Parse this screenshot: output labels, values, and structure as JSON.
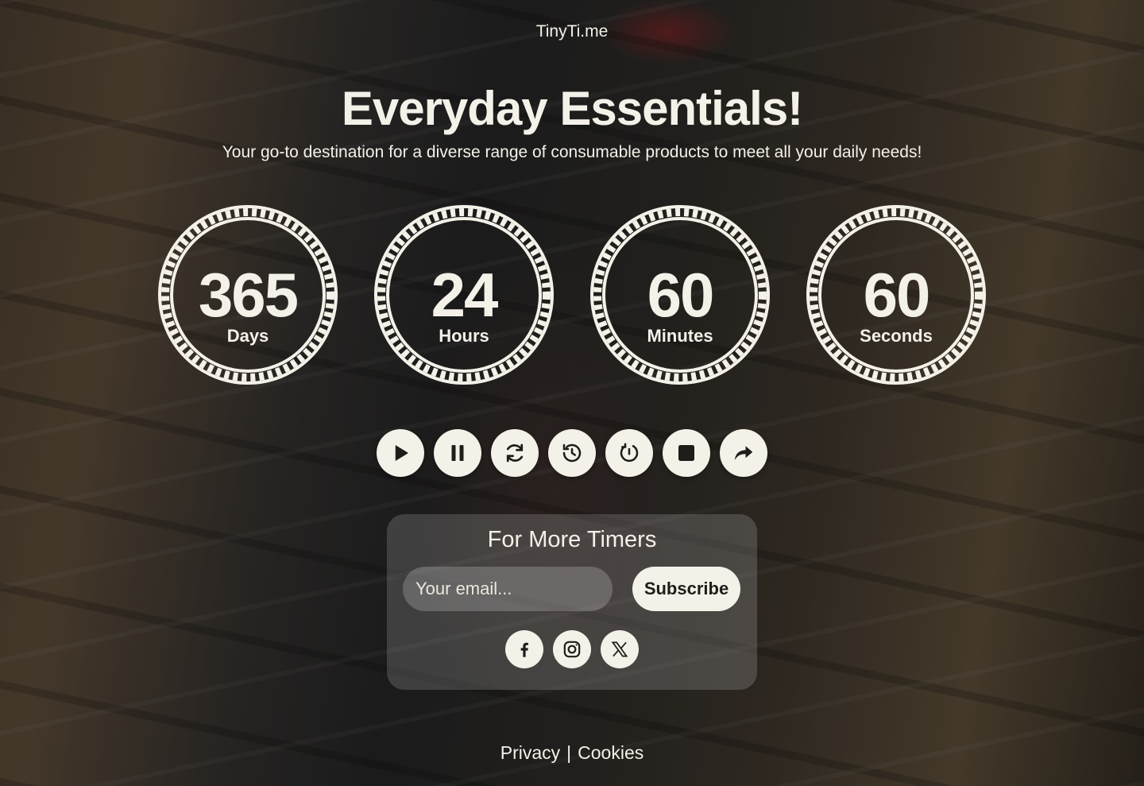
{
  "brand": "TinyTi.me",
  "hero": {
    "title": "Everyday Essentials!",
    "subtitle": "Your go-to destination for a diverse range of consumable products to meet all your daily needs!"
  },
  "countdown": [
    {
      "value": "365",
      "label": "Days"
    },
    {
      "value": "24",
      "label": "Hours"
    },
    {
      "value": "60",
      "label": "Minutes"
    },
    {
      "value": "60",
      "label": "Seconds"
    }
  ],
  "controls": [
    {
      "name": "play-icon"
    },
    {
      "name": "pause-icon"
    },
    {
      "name": "refresh-icon"
    },
    {
      "name": "history-icon"
    },
    {
      "name": "restart-icon"
    },
    {
      "name": "stop-icon"
    },
    {
      "name": "share-icon"
    }
  ],
  "subscribe": {
    "title": "For More Timers",
    "email_placeholder": "Your email...",
    "button_label": "Subscribe"
  },
  "socials": [
    {
      "name": "facebook-icon"
    },
    {
      "name": "instagram-icon"
    },
    {
      "name": "x-icon"
    }
  ],
  "footer": {
    "privacy": "Privacy",
    "separator": "|",
    "cookies": "Cookies"
  },
  "colors": {
    "foreground": "#f4f1e8",
    "dark": "#1f1d1a"
  }
}
